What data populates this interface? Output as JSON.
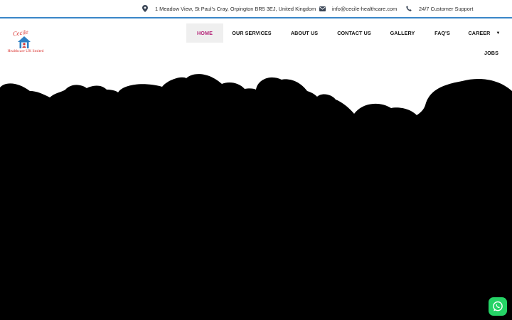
{
  "topbar": {
    "address": "1 Meadow View, St Paul's Cray, Orpington BR5 3EJ, United Kingdom",
    "email": "info@cecile-healthcare.com",
    "support": "24/7 Customer Support"
  },
  "logo": {
    "title": "Cecile",
    "subtitle": "Healthcare UK limited"
  },
  "nav": {
    "home": "HOME",
    "services": "OUR SERVICES",
    "about": "ABOUT US",
    "contact": "CONTACT US",
    "gallery": "GALLERY",
    "faqs": "FAQ'S",
    "career": "CAREER",
    "jobs": "JOBS"
  },
  "colors": {
    "accent": "#b5277a",
    "topbar_border": "#3a86c8",
    "logo_red": "#d9302c",
    "whatsapp": "#25d366"
  },
  "icons": {
    "address": "map-marker-icon",
    "email": "envelope-icon",
    "support": "phone-icon",
    "chat": "whatsapp-icon"
  }
}
